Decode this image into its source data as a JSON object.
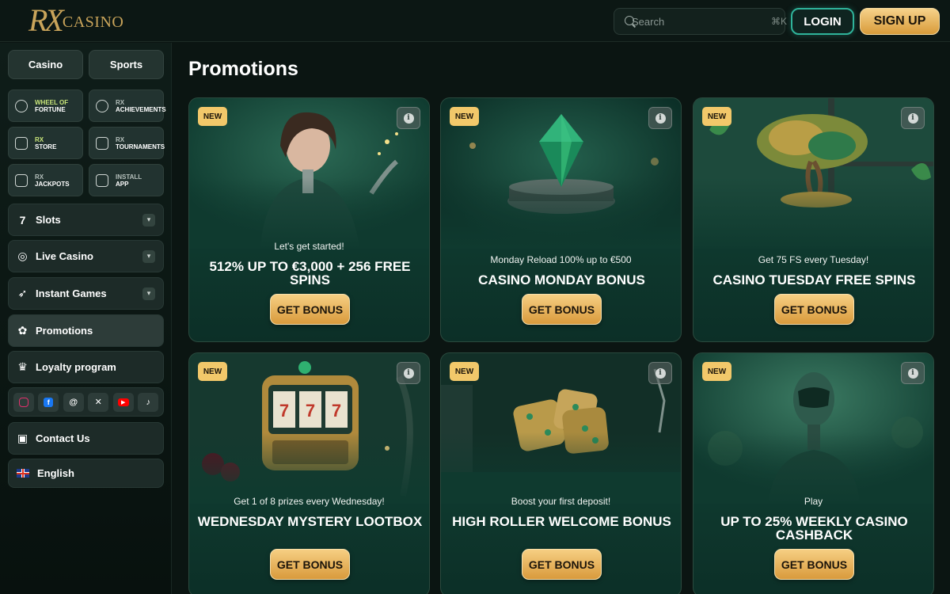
{
  "brand": {
    "rx": "RX",
    "casino": "CASINO"
  },
  "search": {
    "placeholder": "Search",
    "shortcut": "⌘K"
  },
  "auth": {
    "login": "LOGIN",
    "signup": "SIGN UP"
  },
  "sidebar": {
    "tabs": [
      {
        "label": "Casino"
      },
      {
        "label": "Sports"
      }
    ],
    "tiles": [
      {
        "icon": "wheel-icon",
        "line1": "WHEEL OF",
        "line2": "FORTUNE"
      },
      {
        "icon": "achievements-icon",
        "line1": "RX",
        "line2": "ACHIEVEMENTS"
      },
      {
        "icon": "store-icon",
        "line1": "RX",
        "line2": "STORE"
      },
      {
        "icon": "trophy-icon",
        "line1": "RX",
        "line2": "TOURNAMENTS"
      },
      {
        "icon": "jackpot-icon",
        "line1": "RX",
        "line2": "JACKPOTS"
      },
      {
        "icon": "phone-icon",
        "line1": "INSTALL",
        "line2": "APP"
      }
    ],
    "nav": [
      {
        "icon": "seven-icon",
        "label": "Slots"
      },
      {
        "icon": "live-casino-icon",
        "label": "Live Casino"
      },
      {
        "icon": "rocket-icon",
        "label": "Instant Games"
      },
      {
        "icon": "promotions-icon",
        "label": "Promotions"
      },
      {
        "icon": "crown-icon",
        "label": "Loyalty program"
      }
    ],
    "socials": [
      {
        "icon": "instagram-icon",
        "color": "#e1306c"
      },
      {
        "icon": "facebook-icon",
        "color": "#1877f2"
      },
      {
        "icon": "threads-icon",
        "color": "#ffffff"
      },
      {
        "icon": "x-icon",
        "color": "#ffffff"
      },
      {
        "icon": "youtube-icon",
        "color": "#ff0000"
      },
      {
        "icon": "tiktok-icon",
        "color": "#ffffff"
      }
    ],
    "contact": {
      "icon": "chat-icon",
      "label": "Contact Us"
    },
    "language": {
      "icon": "uk-flag-icon",
      "label": "English"
    }
  },
  "main": {
    "title": "Promotions",
    "badge": "NEW",
    "cta": "GET BONUS",
    "cards": [
      {
        "subtitle": "Let's get started!",
        "title": "512% UP TO €3,000 + 256 FREE SPINS"
      },
      {
        "subtitle": "Monday Reload 100% up to €500",
        "title": "CASINO MONDAY BONUS"
      },
      {
        "subtitle": "Get 75 FS every Tuesday!",
        "title": "CASINO TUESDAY FREE SPINS"
      },
      {
        "subtitle": "Get 1 of 8 prizes every Wednesday!",
        "title": "WEDNESDAY MYSTERY LOOTBOX"
      },
      {
        "subtitle": "Boost your first deposit!",
        "title": "HIGH ROLLER WELCOME BONUS"
      },
      {
        "subtitle": "Play",
        "title": "UP TO 25% WEEKLY CASINO CASHBACK"
      }
    ]
  },
  "colors": {
    "accent_gold": "#f2c86a",
    "accent_teal": "#2fb39a",
    "card_green": "#0f3a2f"
  }
}
